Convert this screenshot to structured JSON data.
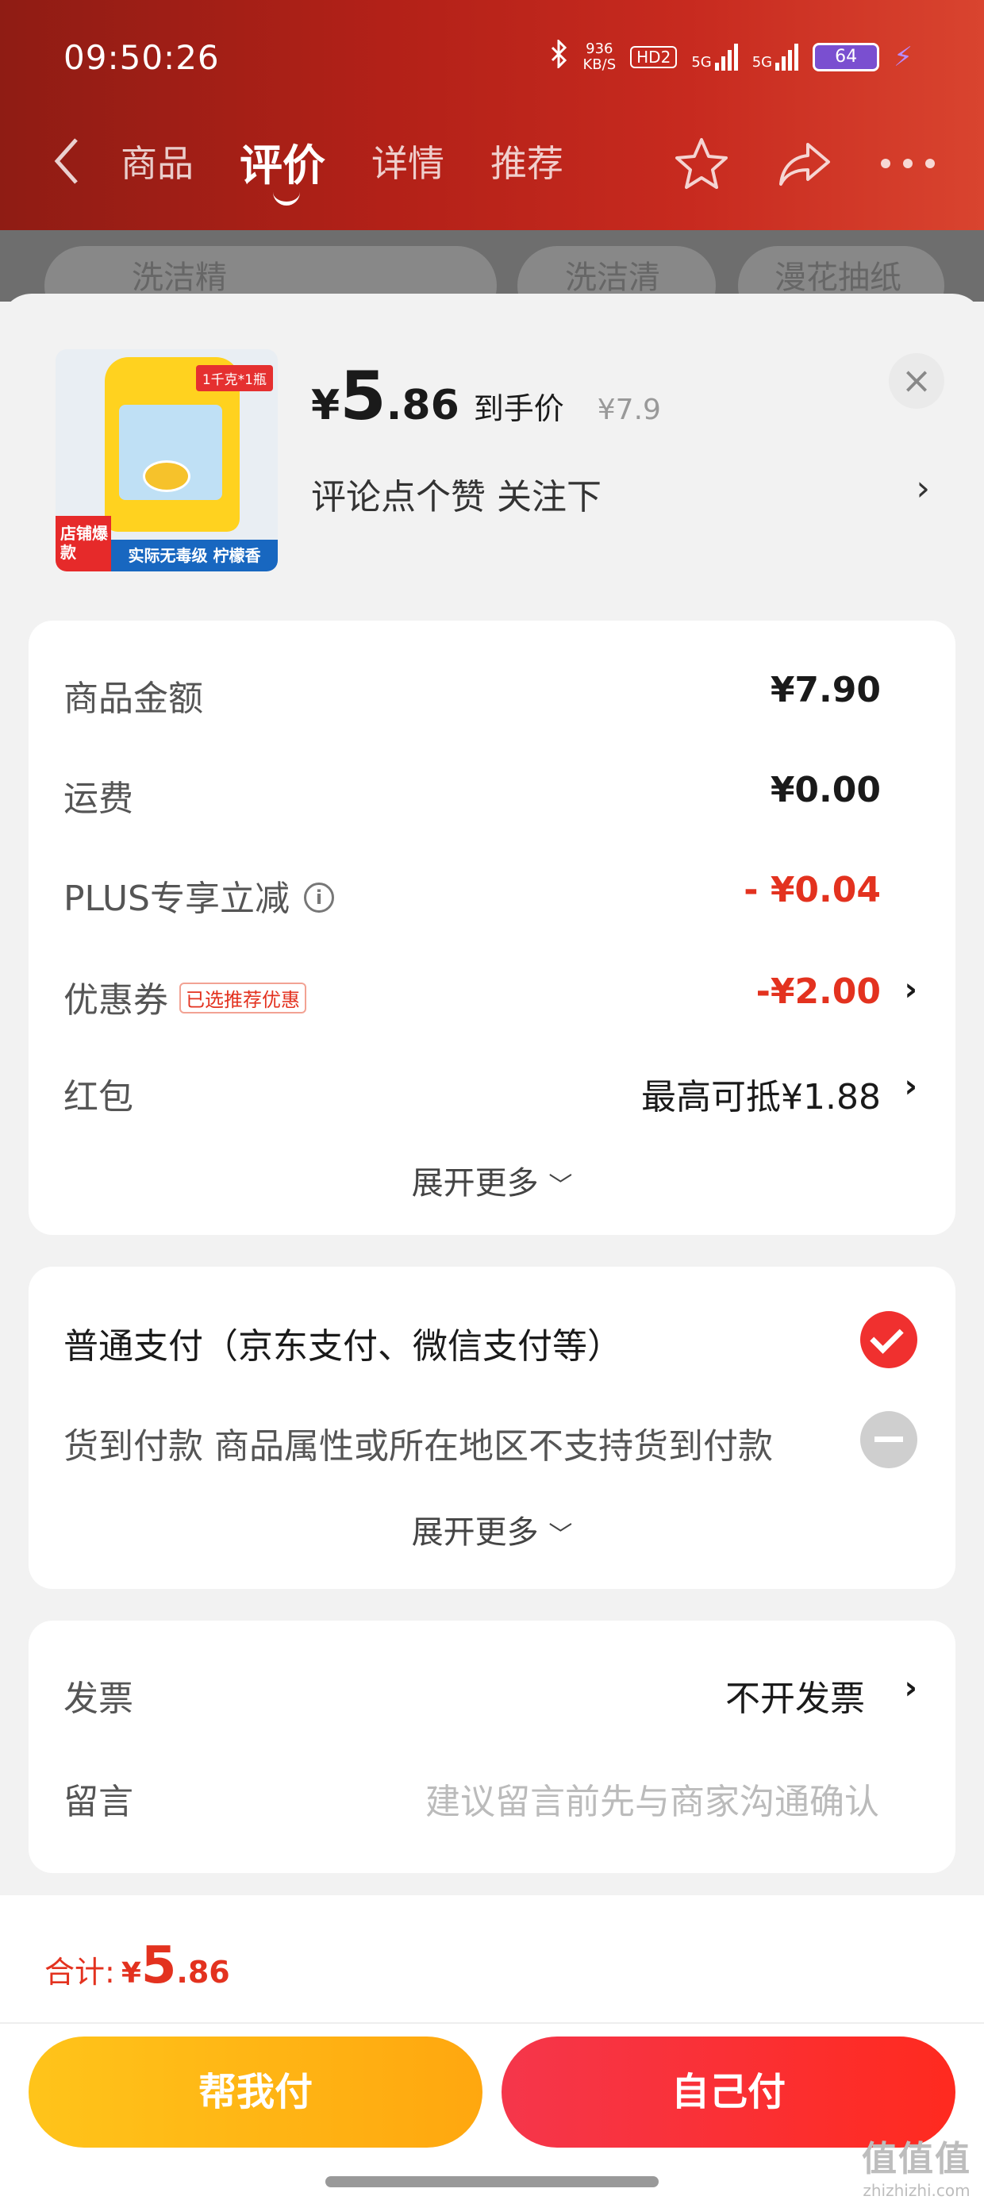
{
  "status_bar": {
    "time": "09:50:26",
    "net_speed": "936",
    "net_unit": "KB/S",
    "hd": "HD2",
    "sig1": "5G",
    "sig2": "5G",
    "battery": "64"
  },
  "nav": {
    "tabs": [
      {
        "label": "商品",
        "active": false
      },
      {
        "label": "评价",
        "active": true
      },
      {
        "label": "详情",
        "active": false
      },
      {
        "label": "推荐",
        "active": false
      }
    ],
    "icons": [
      "back-icon",
      "star-icon",
      "share-icon",
      "more-icon"
    ]
  },
  "background_chips": [
    "洗洁精",
    "洗洁清",
    "漫花抽纸"
  ],
  "product": {
    "thumb_tag": "1千克*1瓶",
    "thumb_hot": "店铺爆款",
    "thumb_strip": "实际无毒级 柠檬香",
    "price_yen": "¥",
    "price_int": "5",
    "price_dec": ".86",
    "price_label": "到手价",
    "original_price": "¥7.9",
    "follow_text": "评论点个赞  关注下",
    "close_icon": "close-icon"
  },
  "summary": {
    "rows": [
      {
        "label": "商品金额",
        "value": "¥7.90"
      },
      {
        "label": "运费",
        "value": "¥0.00"
      },
      {
        "label": "PLUS专享立减",
        "value": "- ¥0.04"
      },
      {
        "label": "优惠券",
        "badge": "已选推荐优惠",
        "value": "-¥2.00"
      },
      {
        "label": "红包",
        "value": "最高可抵¥1.88"
      }
    ],
    "expand": "展开更多"
  },
  "payment": {
    "options": [
      {
        "label": "普通支付（京东支付、微信支付等）",
        "selected": true
      },
      {
        "label": "货到付款 商品属性或所在地区不支持货到付款",
        "selected": false
      }
    ],
    "expand": "展开更多"
  },
  "extra": {
    "invoice_label": "发票",
    "invoice_value": "不开发票",
    "message_label": "留言",
    "message_placeholder": "建议留言前先与商家沟通确认"
  },
  "bottom": {
    "total_label": "合计:",
    "total_yen": "¥",
    "total_int": "5",
    "total_dec": ".86",
    "help_pay": "帮我付",
    "self_pay": "自己付"
  },
  "watermark": {
    "big": "值值值",
    "small": "zhizhizhi.com"
  },
  "colors": {
    "accent_red": "#e3321f",
    "yellow": "#ffb619"
  }
}
